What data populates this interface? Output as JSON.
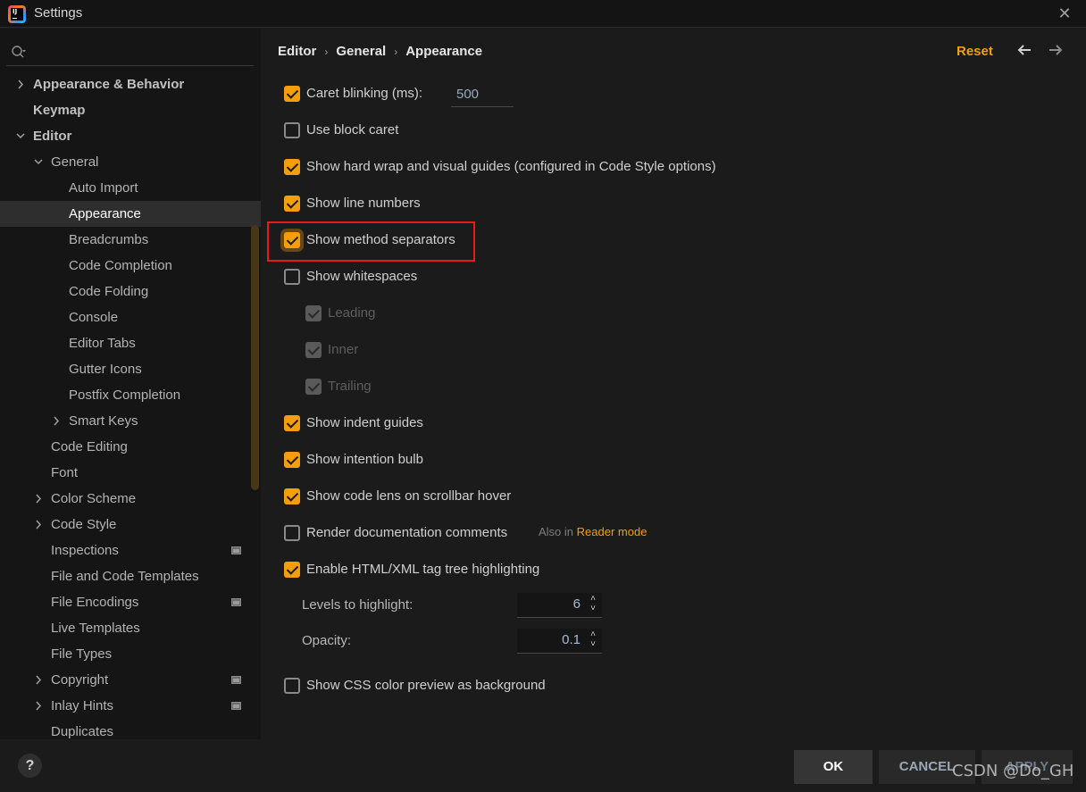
{
  "window": {
    "title": "Settings",
    "close_glyph": "✕"
  },
  "sidebar": {
    "search": {
      "placeholder": "",
      "value": ""
    },
    "items": [
      {
        "label": "Appearance & Behavior",
        "level": 0,
        "expander": "collapsed",
        "bold": true
      },
      {
        "label": "Keymap",
        "level": 0,
        "expander": "none",
        "bold": true
      },
      {
        "label": "Editor",
        "level": 0,
        "expander": "expanded",
        "bold": true
      },
      {
        "label": "General",
        "level": 1,
        "expander": "expanded"
      },
      {
        "label": "Auto Import",
        "level": 2,
        "expander": "none"
      },
      {
        "label": "Appearance",
        "level": 2,
        "expander": "none",
        "selected": true
      },
      {
        "label": "Breadcrumbs",
        "level": 2,
        "expander": "none"
      },
      {
        "label": "Code Completion",
        "level": 2,
        "expander": "none"
      },
      {
        "label": "Code Folding",
        "level": 2,
        "expander": "none"
      },
      {
        "label": "Console",
        "level": 2,
        "expander": "none"
      },
      {
        "label": "Editor Tabs",
        "level": 2,
        "expander": "none"
      },
      {
        "label": "Gutter Icons",
        "level": 2,
        "expander": "none"
      },
      {
        "label": "Postfix Completion",
        "level": 2,
        "expander": "none"
      },
      {
        "label": "Smart Keys",
        "level": 2,
        "expander": "collapsed"
      },
      {
        "label": "Code Editing",
        "level": 1,
        "expander": "none"
      },
      {
        "label": "Font",
        "level": 1,
        "expander": "none"
      },
      {
        "label": "Color Scheme",
        "level": 1,
        "expander": "collapsed"
      },
      {
        "label": "Code Style",
        "level": 1,
        "expander": "collapsed"
      },
      {
        "label": "Inspections",
        "level": 1,
        "expander": "none",
        "project_badge": true
      },
      {
        "label": "File and Code Templates",
        "level": 1,
        "expander": "none"
      },
      {
        "label": "File Encodings",
        "level": 1,
        "expander": "none",
        "project_badge": true
      },
      {
        "label": "Live Templates",
        "level": 1,
        "expander": "none"
      },
      {
        "label": "File Types",
        "level": 1,
        "expander": "none"
      },
      {
        "label": "Copyright",
        "level": 1,
        "expander": "collapsed",
        "project_badge": true
      },
      {
        "label": "Inlay Hints",
        "level": 1,
        "expander": "collapsed",
        "project_badge": true
      },
      {
        "label": "Duplicates",
        "level": 1,
        "expander": "none"
      }
    ]
  },
  "header": {
    "breadcrumb": [
      "Editor",
      "General",
      "Appearance"
    ],
    "breadcrumb_separator": "›",
    "reset_label": "Reset",
    "back_glyph": "🡐",
    "forward_glyph": "🡒"
  },
  "options": [
    {
      "label": "Caret blinking (ms):",
      "checked": true,
      "field_value": "500"
    },
    {
      "label": "Use block caret",
      "checked": false
    },
    {
      "label": "Show hard wrap and visual guides (configured in Code Style options)",
      "checked": true
    },
    {
      "label": "Show line numbers",
      "checked": true
    },
    {
      "label": "Show method separators",
      "checked": true,
      "highlighted": true
    },
    {
      "label": "Show whitespaces",
      "checked": false
    },
    {
      "label": "Leading",
      "checked": true,
      "disabled": true,
      "indent": true
    },
    {
      "label": "Inner",
      "checked": true,
      "disabled": true,
      "indent": true
    },
    {
      "label": "Trailing",
      "checked": true,
      "disabled": true,
      "indent": true
    },
    {
      "label": "Show indent guides",
      "checked": true
    },
    {
      "label": "Show intention bulb",
      "checked": true
    },
    {
      "label": "Show code lens on scrollbar hover",
      "checked": true
    },
    {
      "label": "Render documentation comments",
      "checked": false
    },
    {
      "label": "Enable HTML/XML tag tree highlighting",
      "checked": true
    },
    {
      "label": "Show CSS color preview as background",
      "checked": false
    }
  ],
  "also_in": {
    "prefix": "Also in",
    "link": "Reader mode"
  },
  "tag_tree": {
    "levels_label": "Levels to highlight:",
    "levels_value": "6",
    "opacity_label": "Opacity:",
    "opacity_value": "0.1",
    "spinner_up": "˄",
    "spinner_down": "˅"
  },
  "footer": {
    "help_glyph": "?",
    "ok_label": "OK",
    "cancel_label": "CANCEL",
    "apply_label": "APPLY",
    "watermark": "CSDN @Do_GH"
  },
  "colors": {
    "accent": "#f59e0b",
    "highlight_box": "#e81a1a",
    "background": "#1b1b1b",
    "sidebar_background": "#151515"
  }
}
